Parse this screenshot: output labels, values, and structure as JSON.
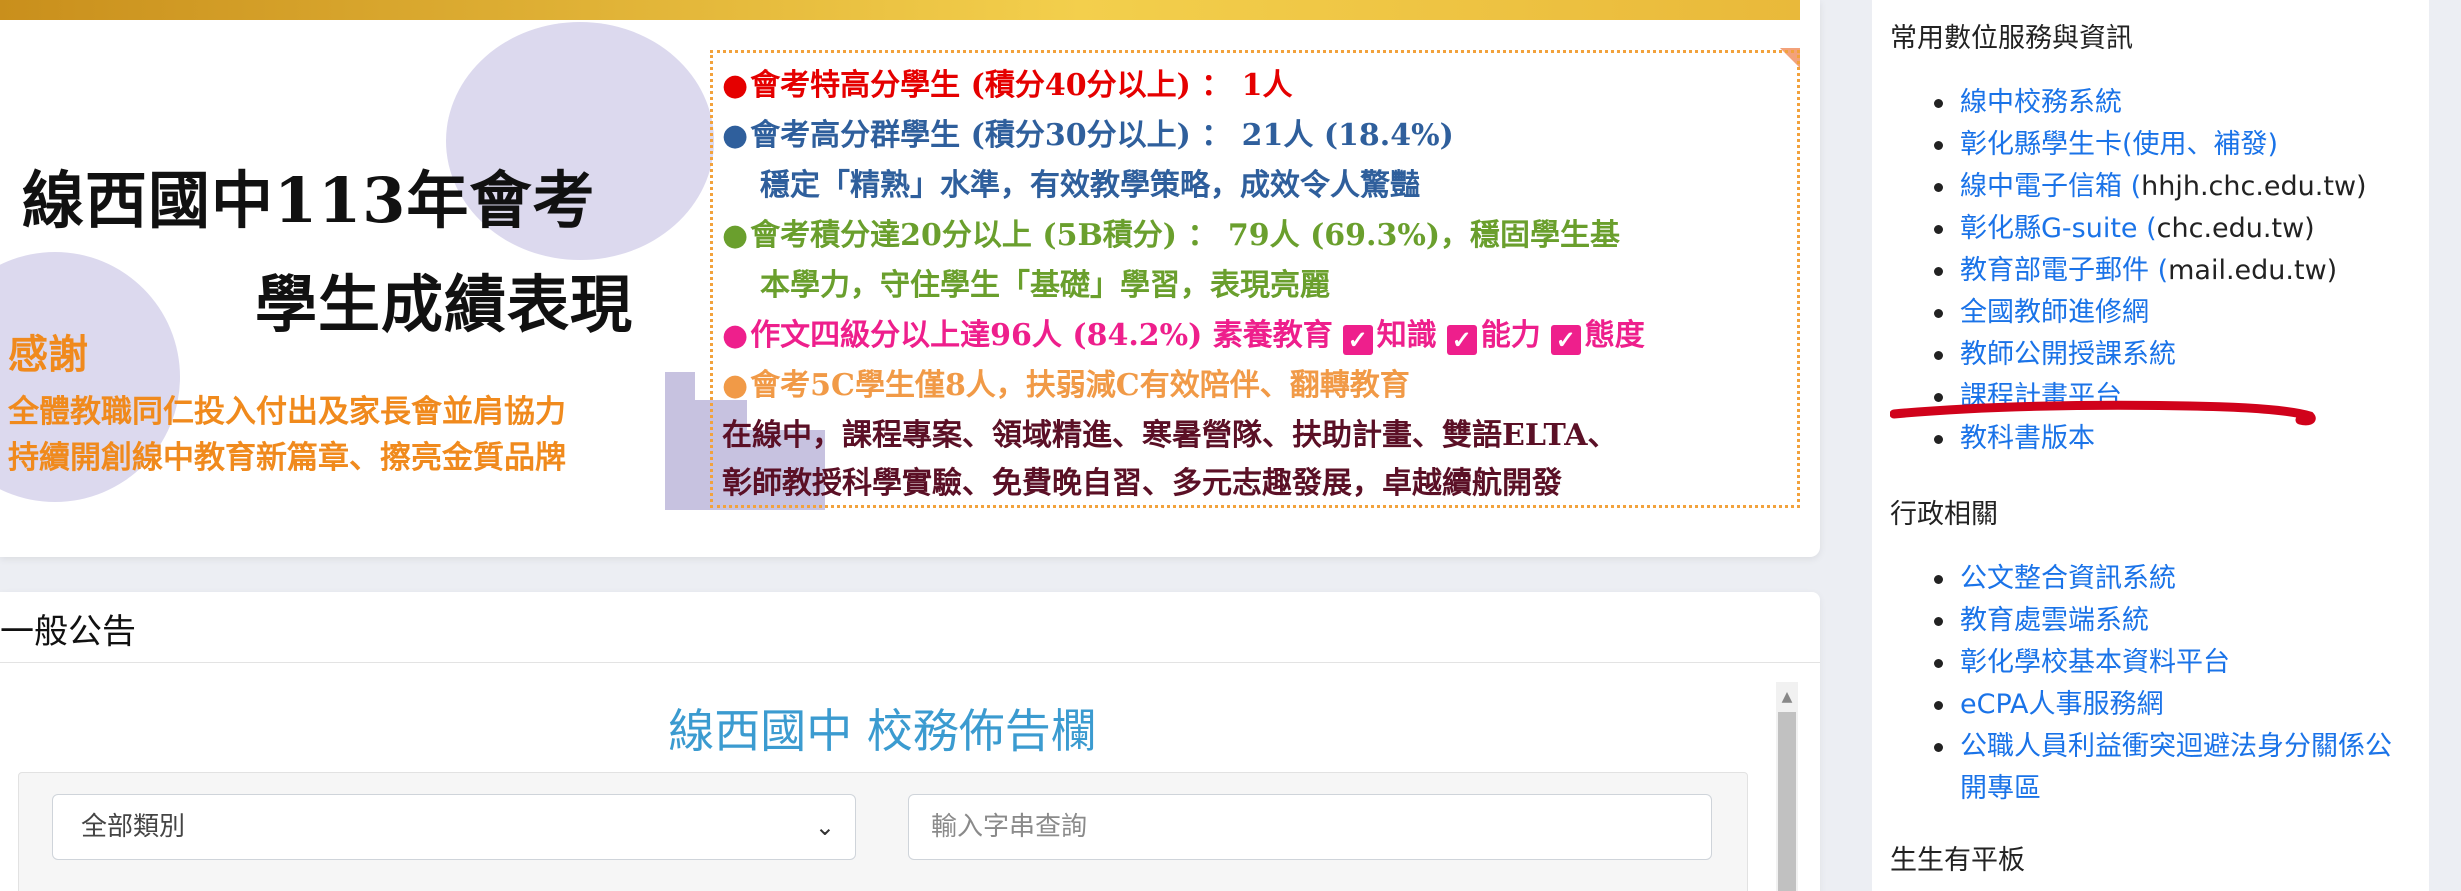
{
  "banner": {
    "title_line1": "線西國中113年會考",
    "title_line2": "學生成績表現",
    "thanks_heading": "感謝",
    "thanks_line1": "全體教職同仁投入付出及家長會並肩協力",
    "thanks_line2": "持續開創線中教育新篇章、擦亮金質品牌",
    "achievements": [
      {
        "marker": "●",
        "text": "會考特高分學生 (積分40分以上) ： 1人",
        "color": "red"
      },
      {
        "marker": "●",
        "text": "會考高分群學生 (積分30分以上) ： 21人 (18.4%)",
        "color": "blue"
      },
      {
        "marker": "",
        "text": "穩定「精熟」水準，有效教學策略，成效令人驚豔",
        "color": "blue"
      },
      {
        "marker": "●",
        "text": "會考積分達20分以上 (5B積分) ： 79人 (69.3%)，穩固學生基",
        "color": "green"
      },
      {
        "marker": "",
        "text": "本學力，守住學生「基礎」學習，表現亮麗",
        "color": "green"
      },
      {
        "marker": "●",
        "text": "作文四級分以上達96人 (84.2%) 素養教育",
        "color": "pink"
      },
      {
        "marker": "●",
        "text": "會考5C學生僅8人，扶弱減C有效陪伴、翻轉教育",
        "color": "orange"
      },
      {
        "marker": "",
        "text": "在線中，課程專案、領域精進、寒暑營隊、扶助計畫、雙語ELTA、",
        "color": "maroon"
      },
      {
        "marker": "",
        "text": "彰師教授科學實驗、免費晚自習、多元志趣發展，卓越續航開發",
        "color": "maroon"
      }
    ],
    "checks": [
      "知識",
      "能力",
      "態度"
    ]
  },
  "announcements": {
    "heading": "一般公告",
    "board_title": "線西國中 校務佈告欄",
    "category_select": "全部類別",
    "search_placeholder": "輸入字串查詢"
  },
  "sidebar": {
    "section1_title": "常用數位服務與資訊",
    "section1_items": [
      {
        "link": "線中校務系統",
        "suffix": ""
      },
      {
        "link": "彰化縣學生卡(使用、補發)",
        "suffix": ""
      },
      {
        "link": "線中電子信箱 (",
        "suffix": "hhjh.chc.edu.tw)"
      },
      {
        "link": "彰化縣G-suite (",
        "suffix": "chc.edu.tw)"
      },
      {
        "link": "教育部電子郵件 (",
        "suffix": "mail.edu.tw)"
      },
      {
        "link": "全國教師進修網",
        "suffix": ""
      },
      {
        "link": "教師公開授課系統",
        "suffix": ""
      },
      {
        "link": "課程計畫平台",
        "suffix": ""
      },
      {
        "link": "教科書版本",
        "suffix": ""
      }
    ],
    "section2_title": "行政相關",
    "section2_items": [
      "公文整合資訊系統",
      "教育處雲端系統",
      "彰化學校基本資料平台",
      "eCPA人事服務網",
      "公職人員利益衝突迴避法身分關係公",
      "開專區"
    ],
    "section3_title": "生生有平板"
  },
  "colors": {
    "link": "#1a73e8",
    "board_title": "#3b9bd0",
    "annotation": "#d0021b"
  }
}
